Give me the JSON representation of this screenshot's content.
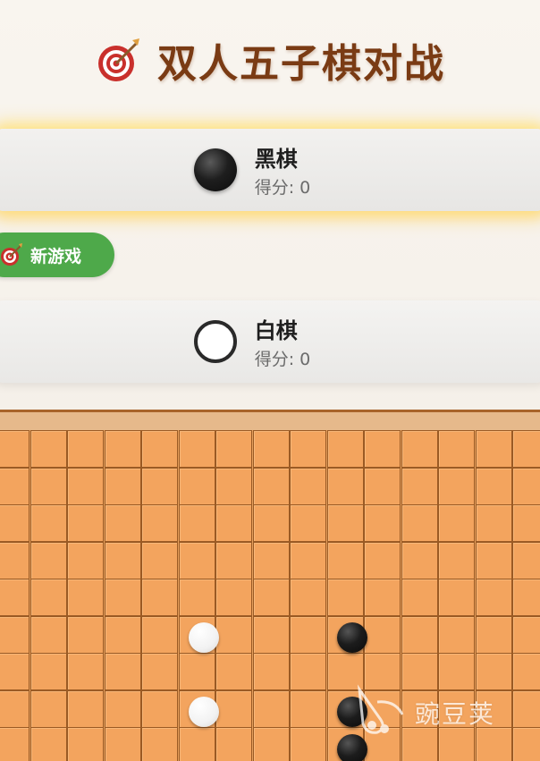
{
  "header": {
    "title": "双人五子棋对战",
    "icon": "target-icon"
  },
  "players": {
    "black": {
      "name": "黑棋",
      "score_text": "得分: 0",
      "stone": "black-stone-icon"
    },
    "white": {
      "name": "白棋",
      "score_text": "得分: 0",
      "stone": "white-stone-icon"
    }
  },
  "controls": {
    "new_game_label": "新游戏",
    "new_game_icon": "target-icon"
  },
  "board": {
    "columns_visible": 15,
    "rows_visible": 9,
    "stones": [
      {
        "color": "white",
        "col": 5,
        "row": 5
      },
      {
        "color": "black",
        "col": 9,
        "row": 5
      },
      {
        "color": "white",
        "col": 5,
        "row": 7
      },
      {
        "color": "black",
        "col": 9,
        "row": 7
      },
      {
        "color": "black",
        "col": 9,
        "row": 8
      }
    ]
  },
  "watermark": {
    "text": "豌豆荚",
    "icon": "wandoujia-logo-icon"
  },
  "colors": {
    "title": "#7a3b14",
    "board": "#f3a45e",
    "grid": "#9a5a24",
    "button": "#4ea94a",
    "panel_glow": "#ffe178"
  }
}
